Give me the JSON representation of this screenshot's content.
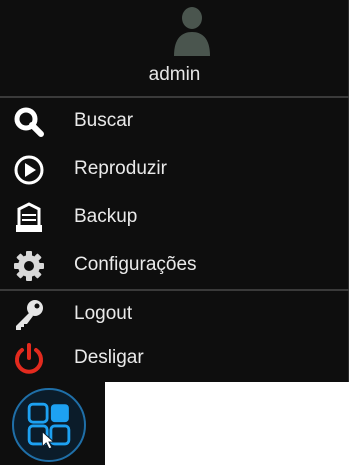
{
  "user": {
    "name": "admin",
    "avatar_icon": "user-silhouette-icon"
  },
  "menu": {
    "items": [
      {
        "label": "Buscar",
        "icon": "search-icon"
      },
      {
        "label": "Reproduzir",
        "icon": "play-icon"
      },
      {
        "label": "Backup",
        "icon": "backup-icon"
      },
      {
        "label": "Configurações",
        "icon": "gear-icon"
      },
      {
        "label": "Logout",
        "icon": "key-icon"
      },
      {
        "label": "Desligar",
        "icon": "power-icon"
      }
    ]
  },
  "taskbar": {
    "launcher_icon": "app-grid-icon"
  },
  "colors": {
    "menu_bg": "#0e0e0e",
    "text": "#eaeaea",
    "power": "#e32a1e",
    "launcher": "#1da1f2"
  }
}
